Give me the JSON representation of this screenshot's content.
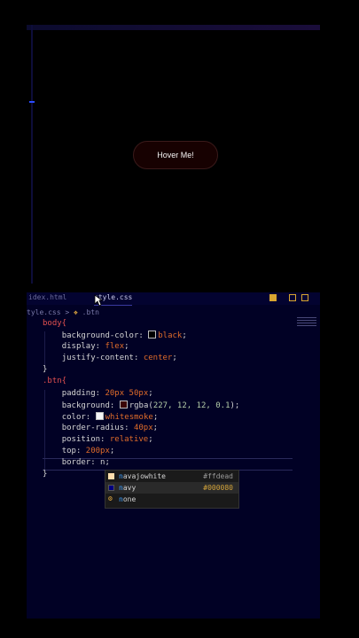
{
  "preview": {
    "button_label": "Hover Me!"
  },
  "tabs": [
    {
      "label": "idex.html"
    },
    {
      "label": "style.css"
    }
  ],
  "breadcrumb": {
    "file": "tyle.css",
    "separator": ">",
    "symbol": ".btn"
  },
  "code": {
    "l1_sel": "body{",
    "l2_prop": "background-color: ",
    "l2_val": "black",
    "l2_end": ";",
    "l3": "display: flex;",
    "l3_prop": "display: ",
    "l3_val": "flex",
    "l4_prop": "justify-content: ",
    "l4_val": "center",
    "l5": "}",
    "l6_sel": ".btn{",
    "l7_prop": "padding: ",
    "l7_val": "20px 50px",
    "l8_prop": "background: ",
    "l8_fn": "rgba(",
    "l8_nums": "227, 12, 12, 0.1",
    "l8_end": ");",
    "l9_prop": "color: ",
    "l9_val": "whitesmoke",
    "l10_prop": "border-radius: ",
    "l10_val": "40px",
    "l11_prop": "position: ",
    "l11_val": "relative",
    "l12_prop": "top: ",
    "l12_val": "200px",
    "l13": "border: n;",
    "l14": "}"
  },
  "suggestions": [
    {
      "prefix": "n",
      "rest": "avajowhite",
      "hex": "#ffdead",
      "color": "#ffdead"
    },
    {
      "prefix": "n",
      "rest": "avy",
      "hex": "#000080",
      "color": "#000080"
    },
    {
      "prefix": "n",
      "rest": "one",
      "hex": "",
      "color": ""
    }
  ],
  "colors": {
    "accent": "#3ea0ff",
    "selector": "#e05050",
    "value": "#e06c2a"
  }
}
